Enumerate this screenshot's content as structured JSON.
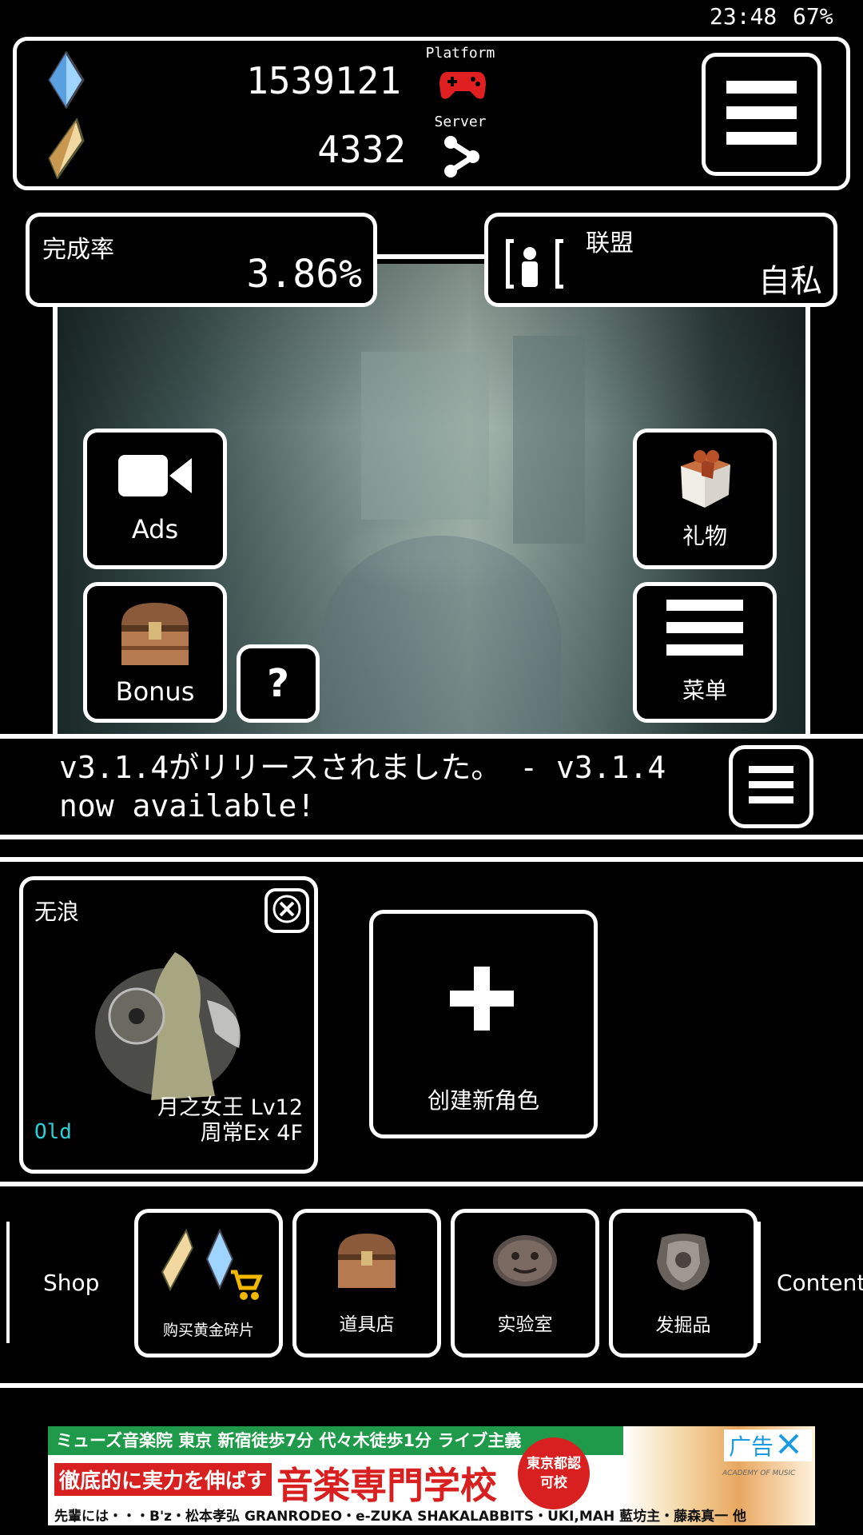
{
  "status_bar": {
    "time": "23:48",
    "battery": "67%"
  },
  "header": {
    "crystal_blue_count": "1539121",
    "crystal_gold_count": "4332",
    "platform_label": "Platform",
    "server_label": "Server",
    "icons": {
      "crystal_blue": "blue-crystal-icon",
      "crystal_gold": "gold-crystal-icon",
      "platform": "gamepad-icon",
      "server": "share-icon",
      "menu": "hamburger-menu-icon"
    },
    "colors": {
      "gamepad": "#e02020"
    }
  },
  "completion": {
    "label": "完成率",
    "value": "3.86%"
  },
  "alliance": {
    "label": "联盟",
    "value": "自私"
  },
  "scene_buttons": {
    "ads": "Ads",
    "gift": "礼物",
    "bonus": "Bonus",
    "help": "?",
    "menu": "菜单"
  },
  "news": {
    "text_line1": "v3.1.4がリリースされました。 - v3.1.4",
    "text_line2": "now available!"
  },
  "characters": {
    "slot1": {
      "name": "无浪",
      "tag": "Old",
      "class_level": "月之女王 Lv12",
      "floor": "周常Ex 4F"
    },
    "create_label": "创建新角色"
  },
  "shop": {
    "label": "Shop",
    "items": [
      {
        "label": "购买黄金碎片",
        "icon": "crystal-cart-icon"
      },
      {
        "label": "道具店",
        "icon": "treasure-chest-icon"
      },
      {
        "label": "实验室",
        "icon": "stone-face-icon"
      },
      {
        "label": "发掘品",
        "icon": "relic-icon"
      }
    ],
    "content_label": "Content"
  },
  "ad_banner": {
    "ad_label": "广告",
    "line1": "ミューズ音楽院 東京 新宿徒歩7分 代々木徒歩1分 ライブ主義",
    "line2a": "徹底的に実力を伸ばす",
    "line2b": "音楽専門学校",
    "stamp": "東京都認可校",
    "line3": "先輩には・・・B'z・松本孝弘 GRANRODEO・e-ZUKA SHAKALABBITS・UKI,MAH 藍坊主・藤森真一 他",
    "brand": "ACADEMY OF MUSIC",
    "colors": {
      "green": "#1f9a4a",
      "red": "#d82020",
      "blue": "#1a9ae0"
    }
  }
}
